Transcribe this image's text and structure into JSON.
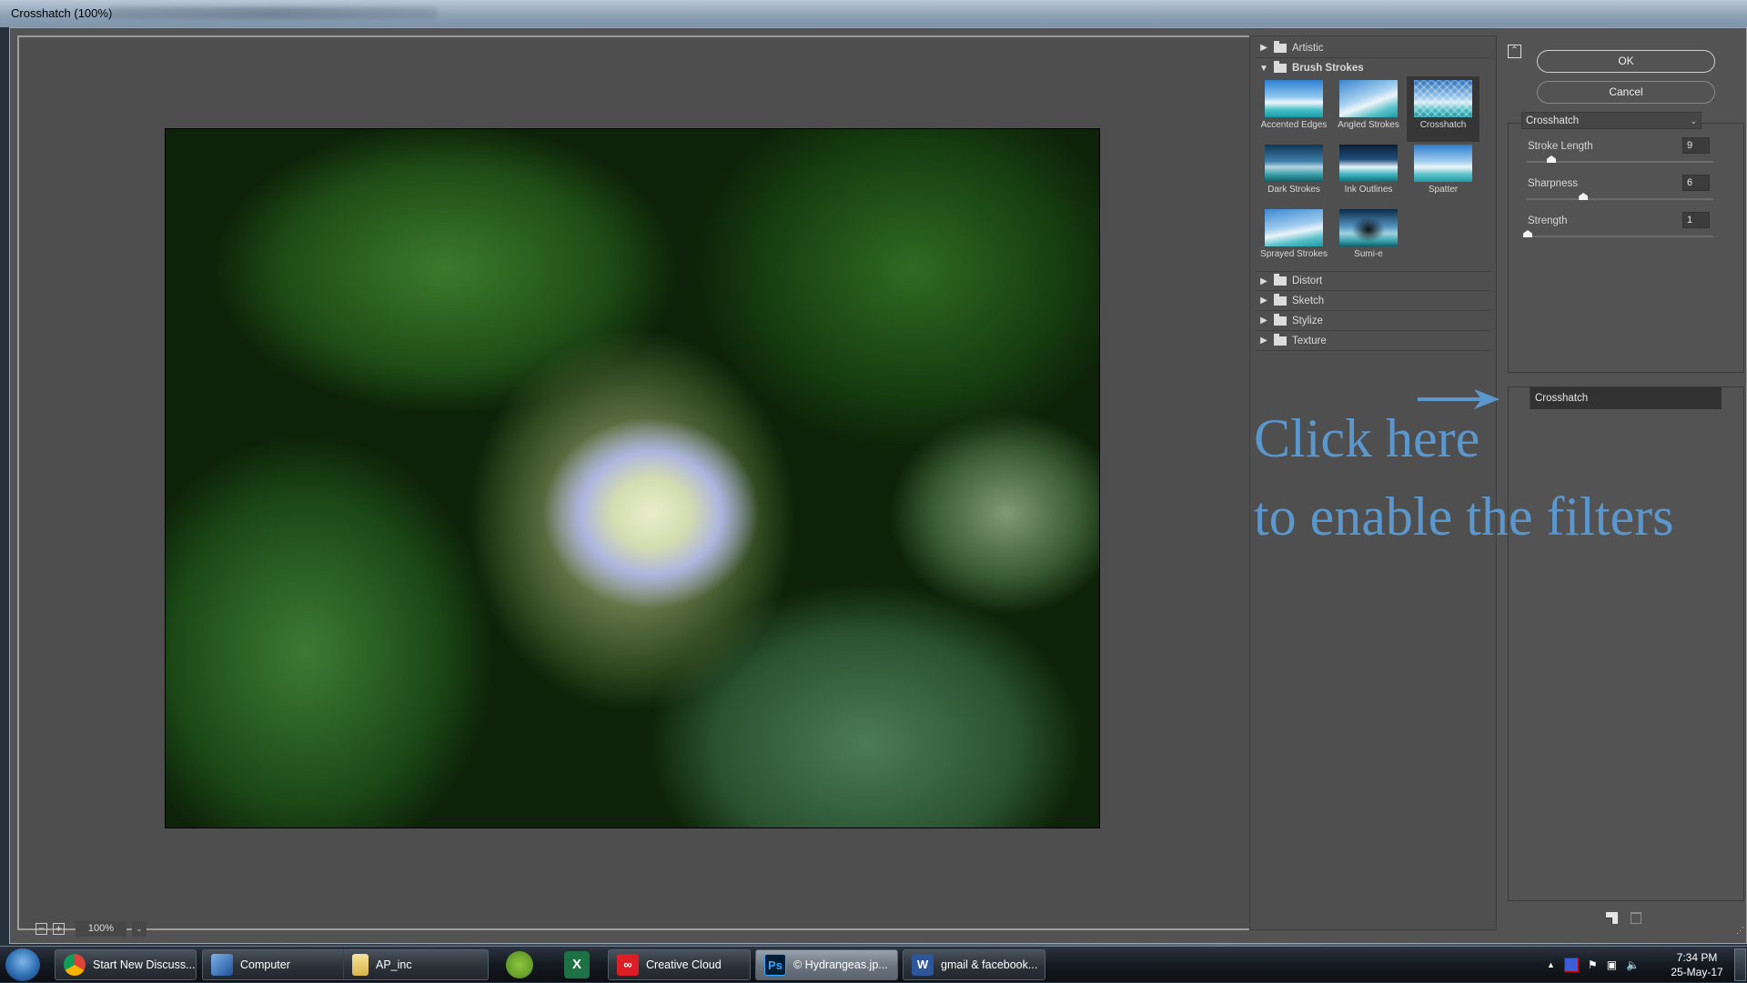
{
  "window": {
    "title": "Crosshatch (100%)"
  },
  "canvas": {
    "zoom_out_label": "−",
    "zoom_in_label": "+",
    "zoom_value": "100%",
    "zoom_dropdown_icon": "chevron-down-icon"
  },
  "filter_gallery": {
    "categories": [
      {
        "label": "Artistic",
        "expanded": false
      },
      {
        "label": "Brush Strokes",
        "expanded": true
      },
      {
        "label": "Distort",
        "expanded": false
      },
      {
        "label": "Sketch",
        "expanded": false
      },
      {
        "label": "Stylize",
        "expanded": false
      },
      {
        "label": "Texture",
        "expanded": false
      }
    ],
    "brush_strokes_filters": [
      {
        "label": "Accented Edges",
        "selected": false
      },
      {
        "label": "Angled Strokes",
        "selected": false
      },
      {
        "label": "Crosshatch",
        "selected": true
      },
      {
        "label": "Dark Strokes",
        "selected": false
      },
      {
        "label": "Ink Outlines",
        "selected": false
      },
      {
        "label": "Spatter",
        "selected": false
      },
      {
        "label": "Sprayed Strokes",
        "selected": false
      },
      {
        "label": "Sumi-e",
        "selected": false
      }
    ]
  },
  "right_panel": {
    "collapse_icon": "double-chevron-up-icon",
    "ok_label": "OK",
    "cancel_label": "Cancel",
    "filter_select": "Crosshatch",
    "params": [
      {
        "label": "Stroke Length",
        "value": "9",
        "min": 3,
        "max": 50
      },
      {
        "label": "Sharpness",
        "value": "6",
        "min": 0,
        "max": 20
      },
      {
        "label": "Strength",
        "value": "1",
        "min": 1,
        "max": 3
      }
    ],
    "effect_layers": [
      {
        "label": "Crosshatch"
      }
    ]
  },
  "annotation": {
    "line1": "Click here",
    "line2": "to enable the filters",
    "color": "#5b97cc"
  },
  "taskbar": {
    "items": [
      {
        "label": "Start New Discuss...",
        "app": "Chrome"
      },
      {
        "label": "Computer",
        "app": "Explorer"
      },
      {
        "label": "AP_inc",
        "app": "Folder"
      },
      {
        "label": "Creative Cloud",
        "app": "Creative Cloud"
      },
      {
        "label": "© Hydrangeas.jp...",
        "app": "Photoshop",
        "active": true
      },
      {
        "label": "gmail & facebook...",
        "app": "Word"
      }
    ],
    "pinned": [
      {
        "app": "CorelDRAW"
      },
      {
        "app": "Excel",
        "glyph": "X"
      }
    ],
    "ps_glyph": "Ps",
    "word_glyph": "W",
    "clock_time": "7:34 PM",
    "clock_date": "25-May-17"
  }
}
